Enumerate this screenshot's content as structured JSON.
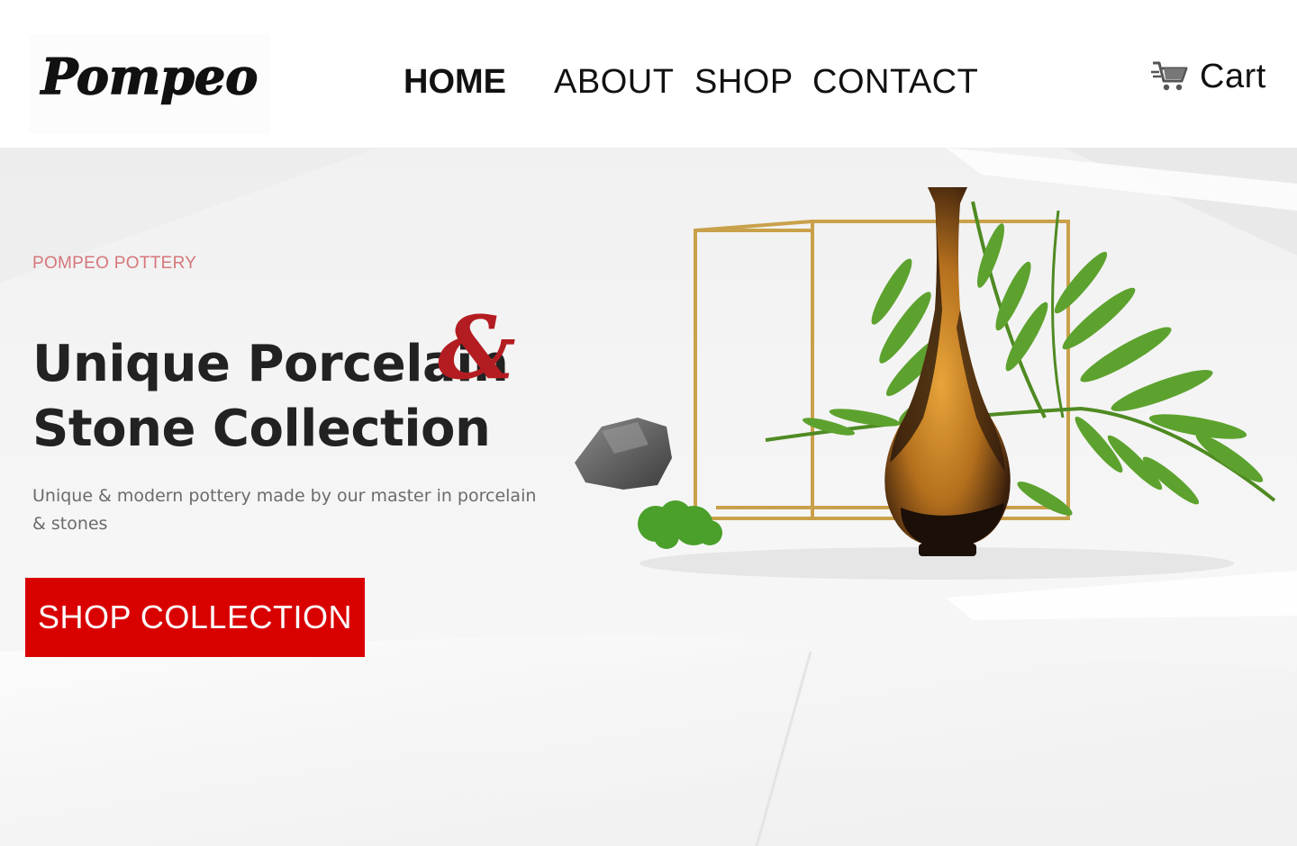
{
  "brand": {
    "logo_text": "Pompeo"
  },
  "nav": {
    "items": [
      {
        "label": "HOME",
        "active": true
      },
      {
        "label": "ABOUT",
        "active": false
      },
      {
        "label": "SHOP",
        "active": false
      },
      {
        "label": "CONTACT",
        "active": false
      }
    ]
  },
  "cart": {
    "label": "Cart",
    "icon": "cart-icon"
  },
  "hero": {
    "eyebrow": "POMPEO POTTERY",
    "headline_line1": "Unique Porcelain",
    "ampersand": "&",
    "headline_line2": "Stone Collection",
    "subtext": "Unique & modern pottery made by our master in porcelain & stones",
    "cta_label": "SHOP COLLECTION"
  },
  "colors": {
    "accent_red": "#d90000",
    "ampersand_red": "#b31c20",
    "eyebrow_pink": "#d6767a",
    "hero_bg": "#f2f2f2"
  }
}
